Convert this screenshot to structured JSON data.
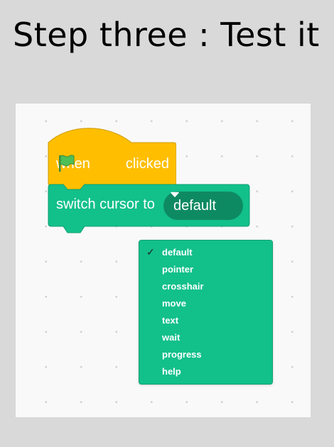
{
  "title": "Step three : Test it",
  "hat_block": {
    "when_label": "when",
    "clicked_label": "clicked",
    "color": "#ffbf00",
    "flag_color": "#4cbf56"
  },
  "cursor_block": {
    "label": "switch cursor to",
    "selected_value": "default",
    "color": "#12c08a",
    "pill_color": "#0e8a62"
  },
  "cursor_menu": {
    "selected": "default",
    "check_icon": "checkmark-icon",
    "items": [
      "default",
      "pointer",
      "crosshair",
      "move",
      "text",
      "wait",
      "progress",
      "help"
    ]
  }
}
